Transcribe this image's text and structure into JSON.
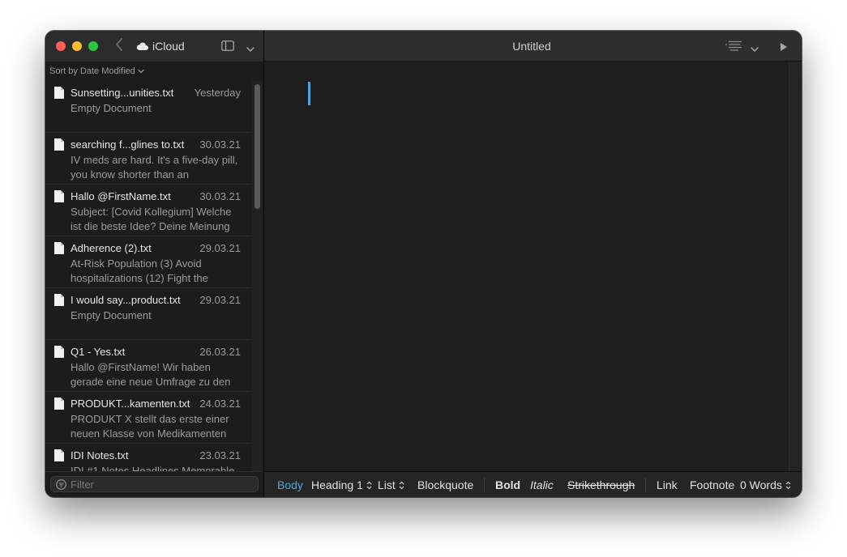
{
  "sidebar": {
    "location": "iCloud",
    "sort_label": "Sort by Date Modified",
    "filter_placeholder": "Filter",
    "documents": [
      {
        "title": "Sunsetting...unities.txt",
        "date": "Yesterday",
        "preview": "Empty Document"
      },
      {
        "title": "searching f...glines to.txt",
        "date": "30.03.21",
        "preview": "IV meds are hard. It's a five-day pill, you know shorter than an"
      },
      {
        "title": "Hallo @FirstName.txt",
        "date": "30.03.21",
        "preview": "Subject: [Covid Kollegium] Welche ist die beste Idee? Deine Meinung"
      },
      {
        "title": "Adherence (2).txt",
        "date": "29.03.21",
        "preview": "At-Risk Population (3) Avoid hospitalizations (12) Fight the"
      },
      {
        "title": "I would say...product.txt",
        "date": "29.03.21",
        "preview": "Empty Document"
      },
      {
        "title": "Q1 - Yes.txt",
        "date": "26.03.21",
        "preview": "Hallo @FirstName! Wir haben gerade eine neue Umfrage zu den"
      },
      {
        "title": "PRODUKT...kamenten.txt",
        "date": "24.03.21",
        "preview": "PRODUKT X stellt das erste einer neuen Klasse von Medikamenten"
      },
      {
        "title": "IDI Notes.txt",
        "date": "23.03.21",
        "preview": "IDI #1 Notes Headlines Memorable"
      }
    ]
  },
  "editor": {
    "title": "Untitled"
  },
  "format_bar": {
    "body": "Body",
    "heading": "Heading 1",
    "list": "List",
    "blockquote": "Blockquote",
    "bold": "Bold",
    "italic": "Italic",
    "strikethrough": "Strikethrough",
    "link": "Link",
    "footnote": "Footnote",
    "word_count": "0 Words"
  },
  "colors": {
    "accent": "#4aa8ea",
    "close": "#ff5f57",
    "minimize": "#febc2e",
    "maximize": "#28c840"
  },
  "icons": {
    "document": "document-icon",
    "location": "cloud-icon",
    "filter": "filter-icon",
    "outline": "outline-icon",
    "preview": "play-icon"
  }
}
